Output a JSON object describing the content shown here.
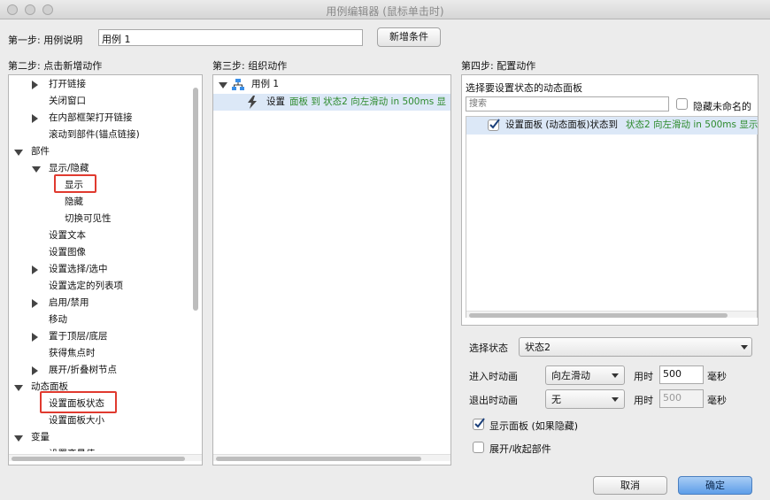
{
  "window": {
    "title": "用例编辑器 (鼠标单击时)"
  },
  "step1": {
    "label": "第一步: 用例说明",
    "case_name": "用例 1",
    "add_condition": "新增条件"
  },
  "step2": {
    "label": "第二步: 点击新增动作",
    "items": [
      {
        "text": "打开链接",
        "arrow": "right"
      },
      {
        "text": "关闭窗口",
        "arrow": ""
      },
      {
        "text": "在内部框架打开链接",
        "arrow": "right"
      },
      {
        "text": "滚动到部件(锚点链接)",
        "arrow": ""
      },
      {
        "text": "部件",
        "arrow": "down"
      },
      {
        "text": "显示/隐藏",
        "arrow": "down"
      },
      {
        "text": "显示",
        "arrow": ""
      },
      {
        "text": "隐藏",
        "arrow": ""
      },
      {
        "text": "切换可见性",
        "arrow": ""
      },
      {
        "text": "设置文本",
        "arrow": ""
      },
      {
        "text": "设置图像",
        "arrow": ""
      },
      {
        "text": "设置选择/选中",
        "arrow": "right"
      },
      {
        "text": "设置选定的列表项",
        "arrow": ""
      },
      {
        "text": "启用/禁用",
        "arrow": "right"
      },
      {
        "text": "移动",
        "arrow": ""
      },
      {
        "text": "置于顶层/底层",
        "arrow": "right"
      },
      {
        "text": "获得焦点时",
        "arrow": ""
      },
      {
        "text": "展开/折叠树节点",
        "arrow": "right"
      },
      {
        "text": "动态面板",
        "arrow": "down"
      },
      {
        "text": "设置面板状态",
        "arrow": ""
      },
      {
        "text": "设置面板大小",
        "arrow": ""
      },
      {
        "text": "变量",
        "arrow": "down"
      },
      {
        "text": "设置变量值",
        "arrow": ""
      }
    ]
  },
  "step3": {
    "label": "第三步: 组织动作",
    "case": "用例 1",
    "action_prefix": "设置",
    "action_detail": "面板 到 状态2 向左滑动 in 500ms 显"
  },
  "step4": {
    "label": "第四步: 配置动作",
    "panel_heading": "选择要设置状态的动态面板",
    "search_placeholder": "搜索",
    "hide_unnamed": "隐藏未命名的",
    "panel_item_prefix": "设置面板 (动态面板)状态到",
    "panel_item_detail": "状态2 向左滑动 in 500ms 显示",
    "select_state_label": "选择状态",
    "select_state_value": "状态2",
    "enter_anim_label": "进入时动画",
    "enter_anim_value": "向左滑动",
    "exit_anim_label": "退出时动画",
    "exit_anim_value": "无",
    "duration_label": "用时",
    "enter_duration": "500",
    "exit_duration": "500",
    "ms": "毫秒",
    "show_panel": "显示面板 (如果隐藏)",
    "expand_collapse": "展开/收起部件"
  },
  "footer": {
    "cancel": "取消",
    "ok": "确定"
  },
  "colors": {
    "accent": "#3b7fd9",
    "highlight": "#e03a2f",
    "selection": "#dce8f7",
    "green_text": "#2e8b2e"
  }
}
